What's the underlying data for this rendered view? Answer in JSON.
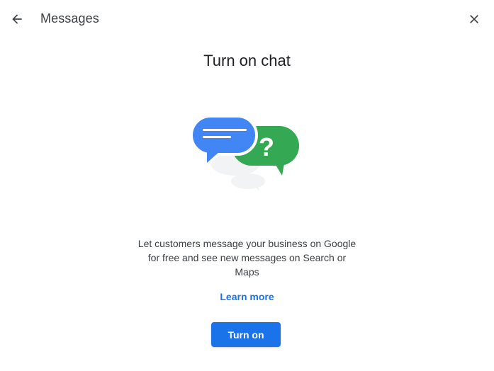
{
  "header": {
    "title": "Messages",
    "back_icon": "arrow-back-icon",
    "close_icon": "close-icon"
  },
  "main": {
    "title": "Turn on chat",
    "illustration_icon": "chat-bubbles-question-icon",
    "description_lines": [
      "Let customers message your business on Google",
      "for free and see new messages on Search or",
      "Maps"
    ],
    "learn_more": "Learn more",
    "turn_on_label": "Turn on"
  },
  "colors": {
    "accent": "#1a73e8",
    "bubble_blue": "#4285f4",
    "bubble_green": "#34a853",
    "title_text": "#202124",
    "body_text": "#3c4043"
  }
}
